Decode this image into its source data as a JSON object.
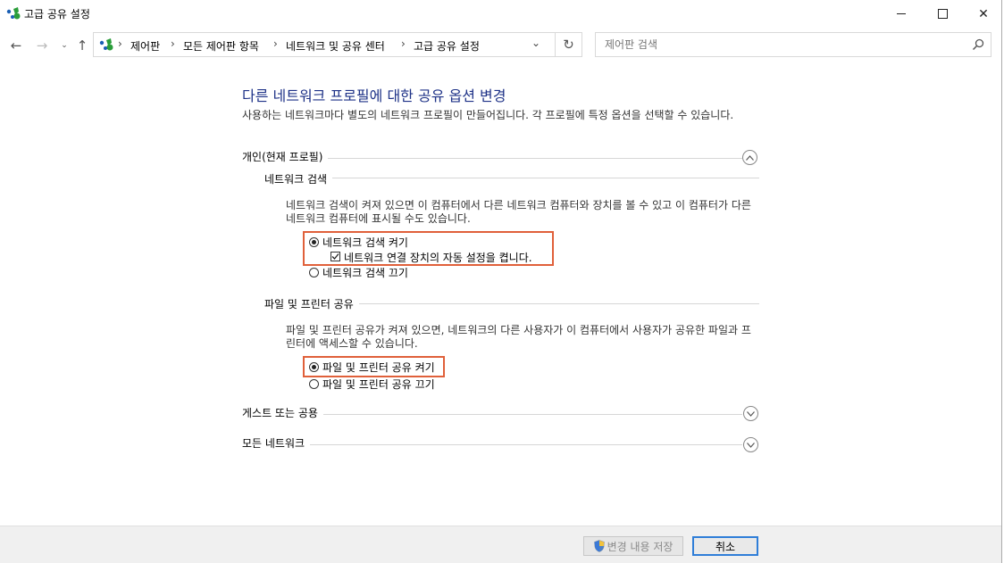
{
  "window": {
    "title": "고급 공유 설정",
    "minimize_glyph": "—",
    "maximize_glyph": "☐",
    "close_glyph": "✕"
  },
  "nav": {
    "back_glyph": "←",
    "forward_glyph": "→",
    "recent_glyph": "⌄",
    "up_glyph": "↑",
    "breadcrumbs": [
      "제어판",
      "모든 제어판 항목",
      "네트워크 및 공유 센터",
      "고급 공유 설정"
    ],
    "separator": "›",
    "dropdown_glyph": "⌄",
    "refresh_glyph": "↻",
    "search_placeholder": "제어판 검색"
  },
  "main": {
    "title": "다른 네트워크 프로필에 대한 공유 옵션 변경",
    "description": "사용하는 네트워크마다 별도의 네트워크 프로필이 만들어집니다. 각 프로필에 특정 옵션을 선택할 수 있습니다.",
    "profiles": {
      "private": {
        "heading": "개인(현재 프로필)",
        "expanded": true,
        "network_discovery": {
          "heading": "네트워크 검색",
          "description": "네트워크 검색이 켜져 있으면 이 컴퓨터에서 다른 네트워크 컴퓨터와 장치를 볼 수 있고 이 컴퓨터가 다른 네트워크 컴퓨터에 표시될 수도 있습니다.",
          "on_label": "네트워크 검색 켜기",
          "on_selected": true,
          "auto_setup_label": "네트워크 연결 장치의 자동 설정을 켭니다.",
          "auto_setup_checked": true,
          "off_label": "네트워크 검색 끄기"
        },
        "file_printer": {
          "heading": "파일 및 프린터 공유",
          "description": "파일 및 프린터 공유가 켜져 있으면, 네트워크의 다른 사용자가 이 컴퓨터에서 사용자가 공유한 파일과 프린터에 액세스할 수 있습니다.",
          "on_label": "파일 및 프린터 공유 켜기",
          "on_selected": true,
          "off_label": "파일 및 프린터 공유 끄기"
        }
      },
      "guest": {
        "heading": "게스트 또는 공용",
        "expanded": false
      },
      "all": {
        "heading": "모든 네트워크",
        "expanded": false
      }
    }
  },
  "footer": {
    "save_label": "변경 내용 저장",
    "cancel_label": "취소"
  },
  "colors": {
    "title_blue": "#1e3287",
    "highlight": "#e0603a",
    "focus_blue": "#2f7ed8"
  }
}
